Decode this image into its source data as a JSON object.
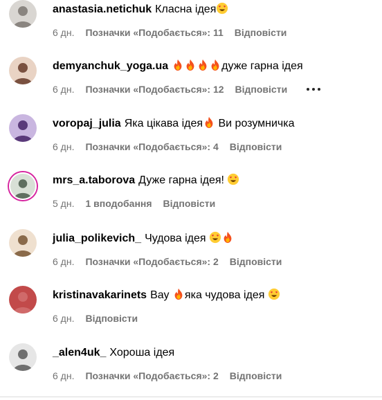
{
  "labels": {
    "reply": "Відповісти",
    "more_icon": "more-options-icon"
  },
  "comments": [
    {
      "username": "anastasia.netichuk",
      "text": "Класна ідея",
      "emoji_after": [
        "love"
      ],
      "emoji_mid": [],
      "text2": "",
      "time": "6 дн.",
      "likes": "Позначки «Подобається»: 11",
      "story": false,
      "more": false
    },
    {
      "username": "demyanchuk_yoga.ua",
      "text": "",
      "emoji_mid": [
        "fire",
        "fire",
        "fire",
        "fire"
      ],
      "text2": "дуже гарна ідея",
      "emoji_after": [],
      "time": "6 дн.",
      "likes": "Позначки «Подобається»: 12",
      "story": false,
      "more": true
    },
    {
      "username": "voropaj_julia",
      "text": "Яка цікава ідея",
      "emoji_mid": [
        "fire"
      ],
      "text2": " Ви розумничка",
      "emoji_after": [],
      "time": "6 дн.",
      "likes": "Позначки «Подобається»: 4",
      "story": false,
      "more": false
    },
    {
      "username": "mrs_a.taborova",
      "text": "Дуже гарна ідея! ",
      "emoji_after": [
        "love"
      ],
      "emoji_mid": [],
      "text2": "",
      "time": "5 дн.",
      "likes": "1 вподобання",
      "story": true,
      "more": false
    },
    {
      "username": "julia_polikevich_",
      "text": "Чудова ідея ",
      "emoji_after": [
        "love",
        "fire"
      ],
      "emoji_mid": [],
      "text2": "",
      "time": "6 дн.",
      "likes": "Позначки «Подобається»: 2",
      "story": false,
      "more": false
    },
    {
      "username": "kristinavakarinets",
      "text": "Вау ",
      "emoji_mid": [
        "fire"
      ],
      "text2": "яка чудова ідея ",
      "emoji_after": [
        "love"
      ],
      "time": "6 дн.",
      "likes": "",
      "story": false,
      "more": false
    },
    {
      "username": "_alen4uk_",
      "text": "Хороша ідея",
      "emoji_after": [],
      "emoji_mid": [],
      "text2": "",
      "time": "6 дн.",
      "likes": "Позначки «Подобається»: 2",
      "story": false,
      "more": false
    }
  ]
}
